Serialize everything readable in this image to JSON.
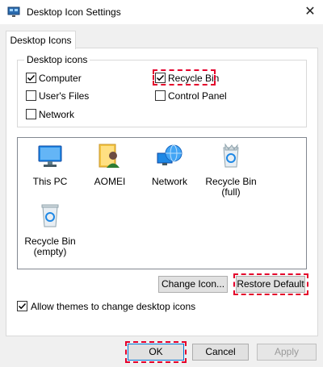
{
  "window": {
    "title": "Desktop Icon Settings",
    "close_glyph": "✕"
  },
  "tab": {
    "label": "Desktop Icons"
  },
  "group": {
    "legend": "Desktop icons",
    "checkboxes": [
      {
        "label": "Computer",
        "checked": true
      },
      {
        "label": "Recycle Bin",
        "checked": true
      },
      {
        "label": "User's Files",
        "checked": false
      },
      {
        "label": "Control Panel",
        "checked": false
      },
      {
        "label": "Network",
        "checked": false
      }
    ]
  },
  "icons": [
    {
      "name": "this-pc",
      "label": "This PC",
      "icon": "monitor-icon"
    },
    {
      "name": "aomei",
      "label": "AOMEI",
      "icon": "user-folder-icon"
    },
    {
      "name": "network",
      "label": "Network",
      "icon": "network-globe-icon"
    },
    {
      "name": "recycle-bin-full",
      "label": "Recycle Bin\n(full)",
      "icon": "recycle-bin-full-icon"
    },
    {
      "name": "recycle-bin-empty",
      "label": "Recycle Bin\n(empty)",
      "icon": "recycle-bin-empty-icon"
    }
  ],
  "buttons": {
    "change_icon": "Change Icon...",
    "restore_default": "Restore Default",
    "ok": "OK",
    "cancel": "Cancel",
    "apply": "Apply"
  },
  "themes_checkbox": {
    "label": "Allow themes to change desktop icons",
    "checked": true
  },
  "colors": {
    "highlight": "#e4002b",
    "accent": "#0078d7"
  }
}
